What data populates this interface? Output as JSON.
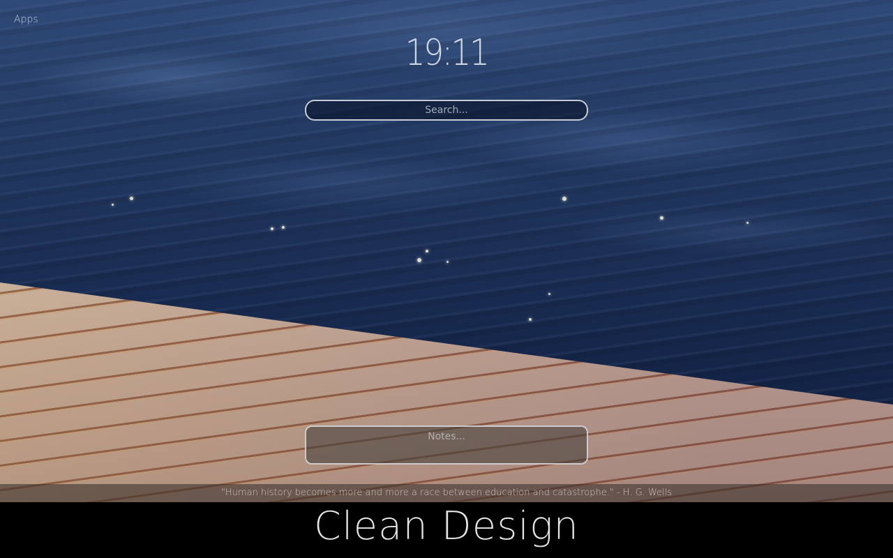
{
  "apps_link": "Apps",
  "clock": {
    "time": "19:11"
  },
  "search": {
    "placeholder": "Search..."
  },
  "notes": {
    "placeholder": "Notes..."
  },
  "quote": {
    "text": "\"Human history becomes more and more a race between education and catastrophe.\" - H. G. Wells"
  },
  "footer": {
    "title": "Clean Design"
  },
  "background": {
    "description": "wooden dock over blue water",
    "water_color": "#1d3158",
    "wood_color": "#c7b4a0"
  }
}
